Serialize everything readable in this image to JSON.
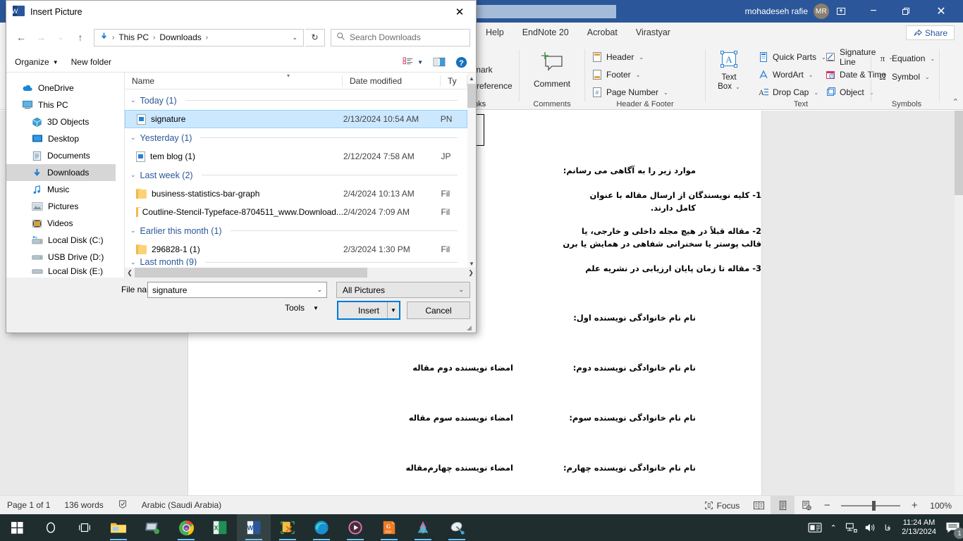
{
  "word": {
    "user_name": "mohadeseh rafie",
    "user_initials": "MR",
    "title_buttons": {
      "restore_up": "⇧",
      "minimize": "−",
      "maximize": "❐",
      "close": "✕"
    },
    "tabs": [
      "Help",
      "EndNote 20",
      "Acrobat",
      "Virastyar"
    ],
    "share_label": "Share",
    "ribbon": {
      "links_remnant": [
        "mark",
        "-reference",
        "nks"
      ],
      "comments": {
        "button": "Comment",
        "group_label": "Comments"
      },
      "header_footer": {
        "items": [
          "Header",
          "Footer",
          "Page Number"
        ],
        "group_label": "Header & Footer"
      },
      "text": {
        "text_box": "Text\nBox",
        "items": [
          "Quick Parts",
          "WordArt",
          "Drop Cap",
          "Signature Line",
          "Date & Time",
          "Object"
        ],
        "group_label": "Text"
      },
      "symbols": {
        "items": [
          "Equation",
          "Symbol"
        ],
        "group_label": "Symbols"
      }
    },
    "document": {
      "lines": [
        "موارد زیر را به آگاهی می رسانم:",
        "1- کلیه نویسندگان از ارسال مقاله با عنوان",
        "کامل دارند.",
        "2- مقاله قبلاً در هیچ مجله داخلی و خارجی، یا",
        "قالب پوستر یا سخنرانی شفاهی در همایش یا برن",
        "3- مقاله تا زمان پایان ارزیابی در نشریه علم"
      ],
      "author_labels": [
        "نام نام خانوادگی نویسنده اول:",
        "نام نام خانوادگی نویسنده دوم:",
        "نام نام خانوادگی نویسنده سوم:",
        "نام نام خانوادگی نویسنده چهارم:"
      ],
      "signature_labels": [
        "امضاء نویسنده دوم مقاله",
        "امضاء نویسنده سوم مقاله",
        "امضاء نویسنده چهارم‌مقاله"
      ]
    },
    "status": {
      "page": "Page 1 of 1",
      "words": "136 words",
      "proofing_icon": "proofing-icon",
      "language": "Arabic (Saudi Arabia)",
      "focus": "Focus",
      "zoom": "100%"
    }
  },
  "dialog": {
    "title": "Insert Picture",
    "app_icon": "word-icon",
    "close_label": "✕",
    "nav": {
      "back": "←",
      "forward": "→",
      "recent": "⌄",
      "up": "↑",
      "breadcrumb": [
        "This PC",
        "Downloads"
      ],
      "breadcrumb_icon": "downloads-arrow-icon",
      "refresh": "↻",
      "search_placeholder": "Search Downloads"
    },
    "toolbar": {
      "organize": "Organize",
      "new_folder": "New folder",
      "view_icon": "view-list-icon",
      "pane_icon": "preview-pane-icon",
      "help_icon": "help-icon"
    },
    "navpane": [
      {
        "label": "OneDrive",
        "icon": "onedrive-icon",
        "indent": false,
        "selected": false
      },
      {
        "label": "This PC",
        "icon": "thispc-icon",
        "indent": false,
        "selected": false
      },
      {
        "label": "3D Objects",
        "icon": "3dobjects-icon",
        "indent": true,
        "selected": false
      },
      {
        "label": "Desktop",
        "icon": "desktop-icon",
        "indent": true,
        "selected": false
      },
      {
        "label": "Documents",
        "icon": "documents-icon",
        "indent": true,
        "selected": false
      },
      {
        "label": "Downloads",
        "icon": "downloads-icon",
        "indent": true,
        "selected": true
      },
      {
        "label": "Music",
        "icon": "music-icon",
        "indent": true,
        "selected": false
      },
      {
        "label": "Pictures",
        "icon": "pictures-icon",
        "indent": true,
        "selected": false
      },
      {
        "label": "Videos",
        "icon": "videos-icon",
        "indent": true,
        "selected": false
      },
      {
        "label": "Local Disk (C:)",
        "icon": "harddisk-icon",
        "indent": true,
        "selected": false
      },
      {
        "label": "USB Drive (D:)",
        "icon": "usbdrive-icon",
        "indent": true,
        "selected": false
      },
      {
        "label": "Local Disk (E:)",
        "icon": "harddisk-icon",
        "indent": true,
        "selected": false
      }
    ],
    "columns": {
      "name": "Name",
      "date_modified": "Date modified",
      "type": "Ty"
    },
    "groups": [
      {
        "header": "Today (1)",
        "rows": [
          {
            "name": "signature",
            "date": "2/13/2024 10:54 AM",
            "type": "PN",
            "icon": "image-file-icon",
            "selected": true
          }
        ]
      },
      {
        "header": "Yesterday (1)",
        "rows": [
          {
            "name": "tem blog (1)",
            "date": "2/12/2024 7:58 AM",
            "type": "JP",
            "icon": "image-file-icon",
            "selected": false
          }
        ]
      },
      {
        "header": "Last week (2)",
        "rows": [
          {
            "name": "business-statistics-bar-graph",
            "date": "2/4/2024 10:13 AM",
            "type": "Fil",
            "icon": "folder-icon",
            "selected": false
          },
          {
            "name": "Coutline-Stencil-Typeface-8704511_www.Download...",
            "date": "2/4/2024 7:09 AM",
            "type": "Fil",
            "icon": "folder-icon",
            "selected": false
          }
        ]
      },
      {
        "header": "Earlier this month (1)",
        "rows": [
          {
            "name": "296828-1 (1)",
            "date": "2/3/2024 1:30 PM",
            "type": "Fil",
            "icon": "folder-icon",
            "selected": false
          }
        ]
      },
      {
        "header": "Last month (9)",
        "rows": []
      }
    ],
    "footer": {
      "filename_label": "File name:",
      "filename_value": "signature",
      "filetype_value": "All Pictures",
      "tools_label": "Tools",
      "insert_label": "Insert",
      "cancel_label": "Cancel"
    }
  },
  "taskbar": {
    "items": [
      {
        "name": "start-button",
        "icon": "windows-logo-icon"
      },
      {
        "name": "cortana-search",
        "icon": "circle-icon"
      },
      {
        "name": "task-view",
        "icon": "taskview-icon"
      },
      {
        "name": "file-explorer",
        "icon": "folder-icon",
        "running": true
      },
      {
        "name": "remote-desktop",
        "icon": "monitor-icon",
        "running": false
      },
      {
        "name": "chrome",
        "icon": "chrome-icon",
        "running": true
      },
      {
        "name": "excel",
        "icon": "excel-icon",
        "running": false
      },
      {
        "name": "word",
        "icon": "word-icon",
        "running": true,
        "active": true
      },
      {
        "name": "snipping-tool",
        "icon": "snip-icon",
        "running": true
      },
      {
        "name": "edge",
        "icon": "edge-icon",
        "running": true
      },
      {
        "name": "media-player",
        "icon": "play-icon",
        "running": true
      },
      {
        "name": "gpdf",
        "icon": "pdf-icon",
        "running": true
      },
      {
        "name": "app-pink",
        "icon": "pink-app-icon",
        "running": true
      },
      {
        "name": "app-satellite",
        "icon": "satellite-icon",
        "running": true
      }
    ],
    "tray": {
      "news_icon": "news-weather-icon",
      "chevron": "⌃",
      "network_icon": "network-icon",
      "volume_icon": "volume-icon",
      "language": "فا",
      "time": "11:24 AM",
      "date": "2/13/2024",
      "notifications_icon": "notifications-icon",
      "notification_count": "1"
    }
  }
}
